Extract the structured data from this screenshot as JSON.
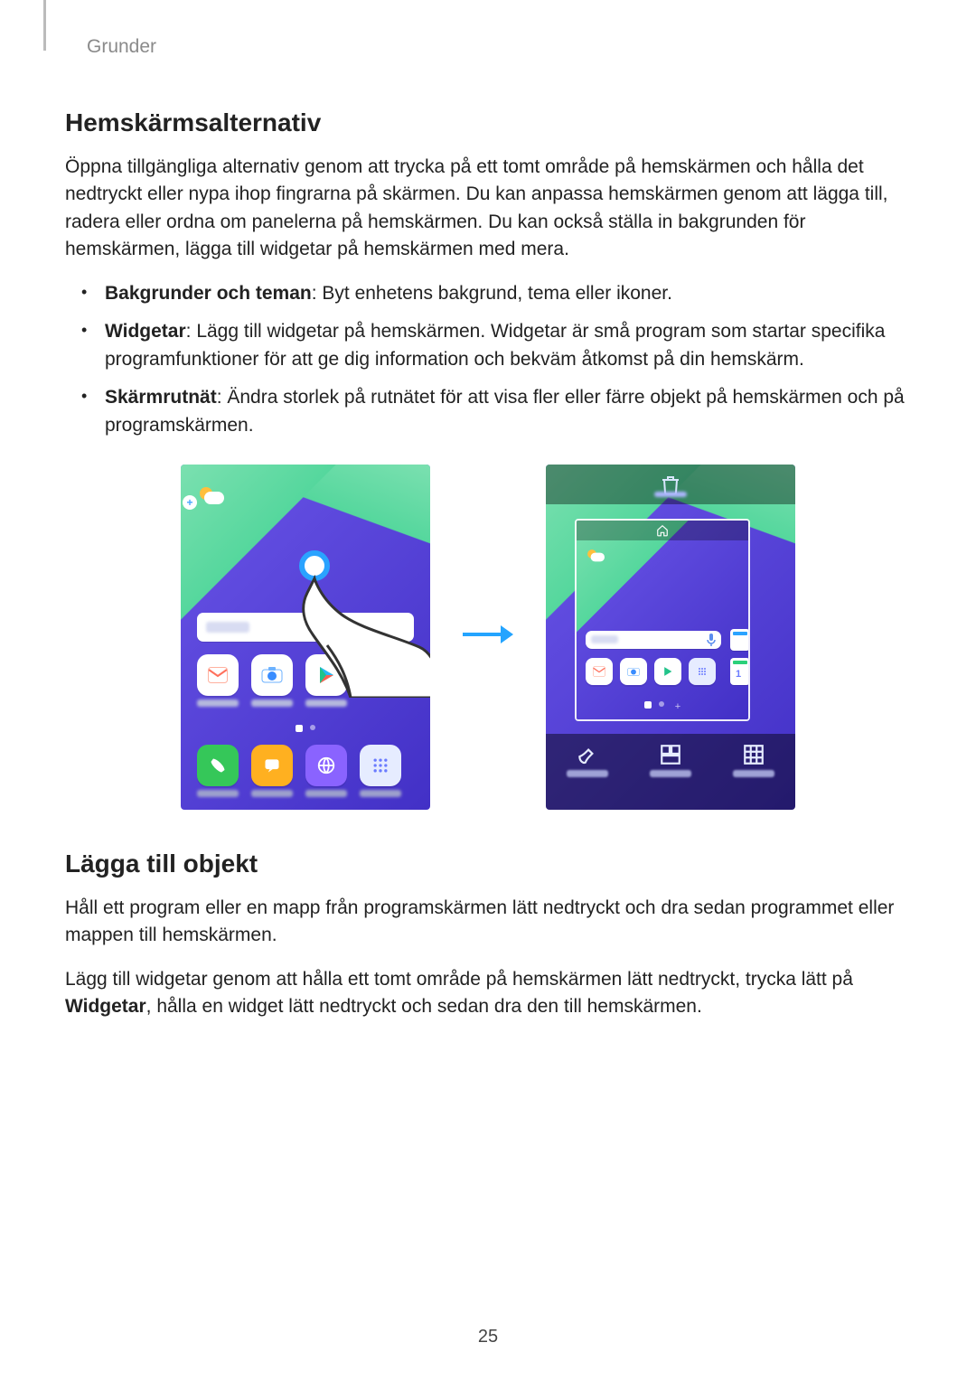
{
  "running_head": "Grunder",
  "page_number": "25",
  "section1": {
    "heading": "Hemskärmsalternativ",
    "intro": "Öppna tillgängliga alternativ genom att trycka på ett tomt område på hemskärmen och hålla det nedtryckt eller nypa ihop fingrarna på skärmen. Du kan anpassa hemskärmen genom att lägga till, radera eller ordna om panelerna på hemskärmen. Du kan också ställa in bakgrunden för hemskärmen, lägga till widgetar på hemskärmen med mera.",
    "bullets": [
      {
        "term": "Bakgrunder och teman",
        "desc": ": Byt enhetens bakgrund, tema eller ikoner."
      },
      {
        "term": "Widgetar",
        "desc": ": Lägg till widgetar på hemskärmen. Widgetar är små program som startar specifika programfunktioner för att ge dig information och bekväm åtkomst på din hemskärm."
      },
      {
        "term": "Skärmrutnät",
        "desc": ": Ändra storlek på rutnätet för att visa fler eller färre objekt på hemskärmen och på programskärmen."
      }
    ]
  },
  "section2": {
    "heading": "Lägga till objekt",
    "p1": "Håll ett program eller en mapp från programskärmen lätt nedtryckt och dra sedan programmet eller mappen till hemskärmen.",
    "p2a": "Lägg till widgetar genom att hålla ett tomt område på hemskärmen lätt nedtryckt, trycka lätt på ",
    "p2_bold": "Widgetar",
    "p2b": ", hålla en widget lätt nedtryckt och sedan dra den till hemskärmen."
  },
  "figure": {
    "left_icons_row1": [
      "mail",
      "camera",
      "play"
    ],
    "dock_icons": [
      "phone",
      "messages",
      "browser",
      "apps"
    ],
    "right_bottom_buttons": [
      "wallpapers",
      "widgets",
      "grid"
    ],
    "colors": {
      "mail": "#ffffff",
      "camera": "#ffffff",
      "play": "#ffffff",
      "phone": "#35c759",
      "messages": "#ffb020",
      "browser": "#8a63ff",
      "apps": "#e6ecff",
      "edge1": "#2aa3ff",
      "edge2": "#2ad07a"
    }
  }
}
